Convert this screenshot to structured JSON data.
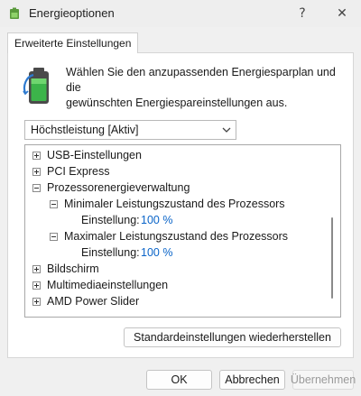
{
  "window": {
    "title": "Energieoptionen",
    "help_glyph": "?",
    "close_glyph": "✕",
    "icon": "power-options-icon"
  },
  "tabs": [
    {
      "label": "Erweiterte Einstellungen",
      "active": true
    }
  ],
  "description": {
    "icon": "battery-power-plan-icon",
    "line1": "Wählen Sie den anzupassenden Energiesparplan und die",
    "line2": "gewünschten Energiespareinstellungen aus."
  },
  "plan_select": {
    "value": "Höchstleistung [Aktiv]",
    "icon": "chevron-down-icon"
  },
  "tree": {
    "usb": "USB-Einstellungen",
    "pci": "PCI Express",
    "cpu": "Prozessorenergieverwaltung",
    "min_state": "Minimaler Leistungszustand des Prozessors",
    "min_setting_label": "Einstellung:",
    "min_setting_value": "100 %",
    "max_state": "Maximaler Leistungszustand des Prozessors",
    "max_setting_label": "Einstellung:",
    "max_setting_value": "100 %",
    "display": "Bildschirm",
    "multimedia": "Multimediaeinstellungen",
    "amd": "AMD Power Slider"
  },
  "buttons": {
    "restore": "Standardeinstellungen wiederherstellen",
    "ok": "OK",
    "cancel": "Abbrechen",
    "apply": "Übernehmen"
  },
  "colors": {
    "link": "#0a64c8",
    "battery_green": "#3cb44a"
  }
}
